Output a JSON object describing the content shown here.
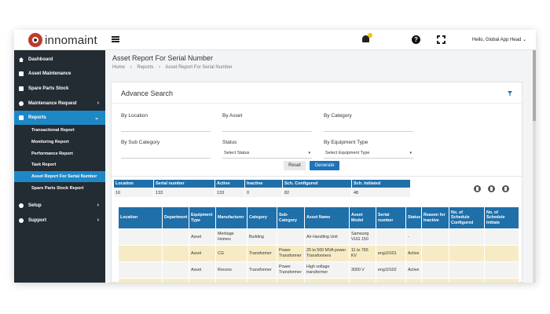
{
  "app": {
    "logo_text": "innomaint",
    "user_greeting": "Hello, Global App Head",
    "user_chevron": "⌄",
    "help_glyph": "?"
  },
  "sidebar": {
    "items": [
      {
        "label": "Dashboard",
        "icon": "home-icon"
      },
      {
        "label": "Asset Maintenance",
        "icon": "asset-icon"
      },
      {
        "label": "Spare Parts Stock",
        "icon": "stock-icon"
      },
      {
        "label": "Maintenance Request",
        "icon": "request-icon",
        "chevron": "›"
      },
      {
        "label": "Reports",
        "icon": "reports-icon",
        "chevron": "⌄"
      },
      {
        "label": "Setup",
        "icon": "setup-icon",
        "chevron": "›"
      },
      {
        "label": "Support",
        "icon": "support-icon",
        "chevron": "›"
      }
    ],
    "report_subitems": [
      "Transactional Report",
      "Monitoring Report",
      "Performance Report",
      "Task Report",
      "Asset Report For Serial Number",
      "Spare Parts Stock Report"
    ]
  },
  "page": {
    "title": "Asset Report For Serial Number",
    "breadcrumb": [
      "Home",
      "›",
      "Reports",
      "›",
      "Asset Report For Serial Number"
    ]
  },
  "search": {
    "title": "Advance Search",
    "fields": {
      "location": {
        "label": "By Location"
      },
      "asset": {
        "label": "By Asset"
      },
      "category": {
        "label": "By Category"
      },
      "sub_category": {
        "label": "By Sub Category"
      },
      "status": {
        "label": "Status",
        "value": "Select Status"
      },
      "equipment_type": {
        "label": "By Equipment Type",
        "value": "Select Equipment Type"
      }
    },
    "caret": "▾",
    "reset_label": "Reset",
    "generate_label": "Generate"
  },
  "summary": {
    "headers": [
      "Location",
      "Serial number",
      "Active",
      "Inactive",
      "Sch. Configured",
      "Sch. Initiated"
    ],
    "values": [
      "16",
      "133",
      "133",
      "0",
      "82",
      "48"
    ]
  },
  "table": {
    "headers": [
      "Location",
      "Department",
      "Equipment Type",
      "Manufacturer",
      "Category",
      "Sub-Category",
      "Asset Name",
      "Asset Model",
      "Serial number",
      "Status",
      "Reason for Inactive",
      "No. of Schedule Configured",
      "No. of Schedule Initiate"
    ],
    "rows": [
      [
        "",
        "",
        "Asset",
        "Meritage Homes",
        "Building",
        "",
        "Air Handling Unit",
        "Samsung VUG 150",
        "",
        "-",
        "",
        "",
        ""
      ],
      [
        "",
        "",
        "Asset",
        "CG",
        "Transformer",
        "Power Transformer",
        "25 to 500 MVA power Transformers",
        "11 to 765 KV",
        "eng10101",
        "Active",
        "",
        "",
        ""
      ],
      [
        "",
        "",
        "Asset",
        "Recons",
        "Transformer",
        "Power Transformer",
        "High voltage transformer",
        "3000 V",
        "eng10102",
        "Active",
        "",
        "",
        ""
      ],
      [
        "",
        "",
        "",
        "",
        "",
        "",
        "",
        "",
        "",
        "",
        "",
        "",
        ""
      ]
    ]
  }
}
